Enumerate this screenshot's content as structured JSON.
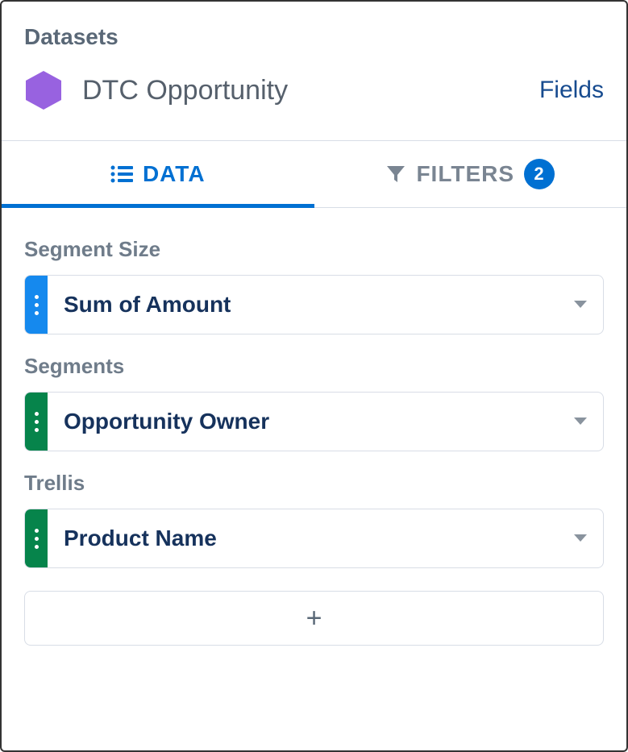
{
  "header": {
    "title": "Datasets",
    "dataset_name": "DTC Opportunity",
    "fields_link": "Fields"
  },
  "tabs": {
    "data_label": "DATA",
    "filters_label": "FILTERS",
    "filters_count": "2"
  },
  "sections": {
    "segment_size": {
      "label": "Segment Size",
      "value": "Sum of Amount",
      "handle_color": "blue"
    },
    "segments": {
      "label": "Segments",
      "value": "Opportunity Owner",
      "handle_color": "green"
    },
    "trellis": {
      "label": "Trellis",
      "value": "Product Name",
      "handle_color": "green"
    }
  },
  "add_button": "+"
}
